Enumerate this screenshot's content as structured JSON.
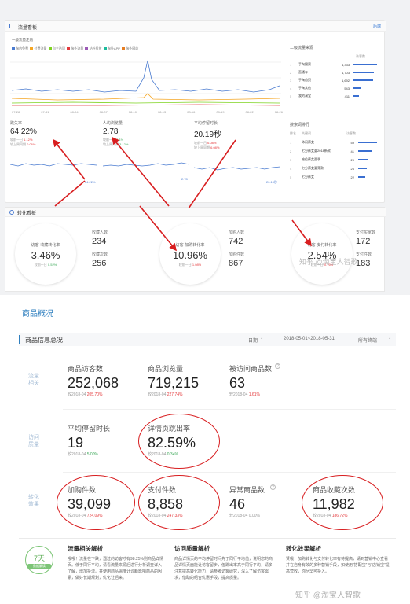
{
  "top": {
    "traffic_panel_title": "流量看板",
    "traffic_panel_link": "后端",
    "chart_title": "一级流量走向",
    "legend": [
      "淘内免费",
      "付费流量",
      "自主访问",
      "淘外流量",
      "站外投放",
      "淘外APP",
      "淘外网站"
    ],
    "xaxis": [
      "07-28",
      "07-31",
      "08-04",
      "08-07",
      "08-10",
      "08-13",
      "08-16",
      "08-19",
      "08-22",
      "08-26"
    ],
    "sub_metrics": [
      {
        "label": "跳失率",
        "value": "64.22%",
        "cmp1": "较前一日",
        "cmp1_val": "1.12%",
        "cmp2": "较上周同期",
        "cmp2_val": "0.06%",
        "end_val": "64.22%"
      },
      {
        "label": "人均浏览量",
        "value": "2.78",
        "cmp1": "较前一日",
        "cmp1_val": "4.1%",
        "cmp2": "较上周同期",
        "cmp2_val": "3.12%",
        "end_val": "2.78"
      },
      {
        "label": "平均停留时长",
        "value": "20.19秒",
        "cmp1": "较前一日",
        "cmp1_val": "6.08%",
        "cmp2": "较上周同期",
        "cmp2_val": "6.08%",
        "end_val": "20.19秒"
      }
    ],
    "sources_title": "二级流量来源",
    "sources_col": "访客数",
    "sources": [
      {
        "rank": "1",
        "name": "手淘搜索",
        "value": "1,333"
      },
      {
        "rank": "2",
        "name": "直通车",
        "value": "1,703"
      },
      {
        "rank": "3",
        "name": "手淘首页",
        "value": "1,692"
      },
      {
        "rank": "4",
        "name": "手淘其他",
        "value": "543"
      },
      {
        "rank": "5",
        "name": "我的淘宝",
        "value": "411"
      }
    ],
    "search_title": "搜索词排行",
    "search_cols": [
      "排名",
      "关键词",
      "访客数"
    ],
    "search": [
      {
        "rank": "1",
        "name": "休闲裤女",
        "value": "59"
      },
      {
        "rank": "2",
        "name": "七分裤女夏2018新款",
        "value": "41"
      },
      {
        "rank": "3",
        "name": "哈伦裤女夏季",
        "value": "29"
      },
      {
        "rank": "4",
        "name": "七分裤女夏薄款",
        "value": "26"
      },
      {
        "rank": "5",
        "name": "七分裤女",
        "value": "22"
      }
    ],
    "conv_title": "转化看板",
    "conv_circles": [
      {
        "label": "访客-收藏转化率",
        "value": "3.46%",
        "cmp": "较前一日",
        "cmp_val": "0.52%"
      },
      {
        "label": "访客-加购转化率",
        "value": "10.96%",
        "cmp": "较前一日",
        "cmp_val": "1.08%"
      },
      {
        "label": "访客-支付转化率",
        "value": "2.54%",
        "cmp": "较前一日",
        "cmp_val": "0.76%"
      }
    ],
    "conv_side": [
      [
        {
          "label": "收藏人数",
          "value": "234"
        },
        {
          "label": "收藏次数",
          "value": "256"
        }
      ],
      [
        {
          "label": "加购人数",
          "value": "742"
        },
        {
          "label": "加购件数",
          "value": "867"
        }
      ],
      [
        {
          "label": "支付买家数",
          "value": "172"
        },
        {
          "label": "支付件数",
          "value": "183"
        }
      ]
    ],
    "watermark": "知乎 @淘宝人智歌"
  },
  "bottom": {
    "title": "商品概况",
    "info_title": "商品信息总况",
    "filter_label": "日期",
    "date_range": "2018-05-01~2018-05-31",
    "terminal": "所有终端",
    "groups": [
      {
        "name": "流量相关"
      },
      {
        "name": "访问质量"
      },
      {
        "name": "转化效果"
      }
    ],
    "row1": [
      {
        "label": "商品访客数",
        "value": "252,068",
        "cmp": "较2018-04",
        "pct": "205.70%",
        "dir": "up"
      },
      {
        "label": "商品浏览量",
        "value": "719,215",
        "cmp": "较2018-04",
        "pct": "227.74%",
        "dir": "up"
      },
      {
        "label": "被访问商品数",
        "value": "63",
        "cmp": "较2018-04",
        "pct": "1.61%",
        "dir": "up"
      }
    ],
    "row2": [
      {
        "label": "平均停留时长",
        "value": "19",
        "cmp": "较2018-04",
        "pct": "5.00%",
        "dir": "dn"
      },
      {
        "label": "详情页跳出率",
        "value": "82.59%",
        "cmp": "较2018-04",
        "pct": "0.34%",
        "dir": "dn"
      }
    ],
    "row3": [
      {
        "label": "加购件数",
        "value": "39,099",
        "cmp": "较2018-04",
        "pct": "724.09%",
        "dir": "up"
      },
      {
        "label": "支付件数",
        "value": "8,858",
        "cmp": "较2018-04",
        "pct": "247.33%",
        "dir": "up"
      },
      {
        "label": "异常商品数",
        "value": "46",
        "cmp": "较2018-04",
        "pct": "0.00%",
        "dir": "flat"
      },
      {
        "label": "商品收藏次数",
        "value": "11,982",
        "cmp": "较2018-04",
        "pct": "186.72%",
        "dir": "up"
      }
    ],
    "badge_num": "7天",
    "badge_text": "数据解读",
    "analysis": [
      {
        "title": "流量相关解析",
        "text": "哦哦！流量在下跌，遇过的访客才有98.25%则商品详情页。低于同行平均，请看流量来源后进行分析调查详入了解，增加投流。并使用商品温度计诊断影响商品的因素，做好长期规划，优化让后来。"
      },
      {
        "title": "访问质量解析",
        "text": "商品详情页的平均停留时间先于同行平均值，说明您的商品详情页面能让访客留步，但跳出率高于同行平均，请多注意提高转化能力，请参考访客研究，深入了解访客需求，借助的组合优惠手段，提高质量。"
      },
      {
        "title": "转化效果解析",
        "text": "赞哦！加购转化与支付转化率有待提高，请到营销中心查看并在自身有效的多种营销手段，如使用“搭配宝”与“店铺宝”提高营收，你尽早可投入。"
      }
    ],
    "watermark": "知乎 @淘宝人智歌"
  }
}
